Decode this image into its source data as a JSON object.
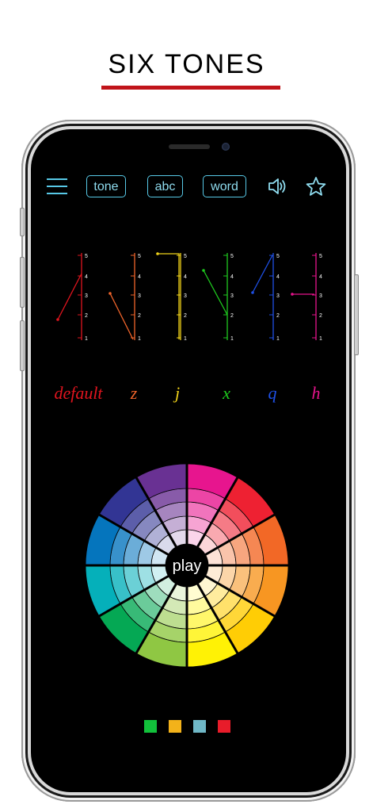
{
  "page_title": "SIX TONES",
  "toolbar": {
    "menu_icon": "hamburger-menu-icon",
    "tone_label": "tone",
    "abc_label": "abc",
    "word_label": "word",
    "sound_icon": "speaker-volume-icon",
    "favorite_icon": "star-outline-icon"
  },
  "tones": [
    {
      "label": "default",
      "color": "#e0141e"
    },
    {
      "label": "z",
      "color": "#f0642a"
    },
    {
      "label": "j",
      "color": "#f0d21a"
    },
    {
      "label": "x",
      "color": "#1ec81e"
    },
    {
      "label": "q",
      "color": "#1e50e6"
    },
    {
      "label": "h",
      "color": "#e6148c"
    }
  ],
  "scale_numbers": [
    "5",
    "4",
    "3",
    "2",
    "1"
  ],
  "wheel": {
    "center_label": "play",
    "hues": [
      "#e6108c",
      "#ee1c2e",
      "#f26522",
      "#f7941d",
      "#ffcc00",
      "#fff200",
      "#8dc63f",
      "#00a651",
      "#00aeb9",
      "#0072bc",
      "#2e3192",
      "#662d91"
    ]
  },
  "swatches": [
    "#12c13b",
    "#f3b21a",
    "#6fb7c6",
    "#e81c2a"
  ]
}
